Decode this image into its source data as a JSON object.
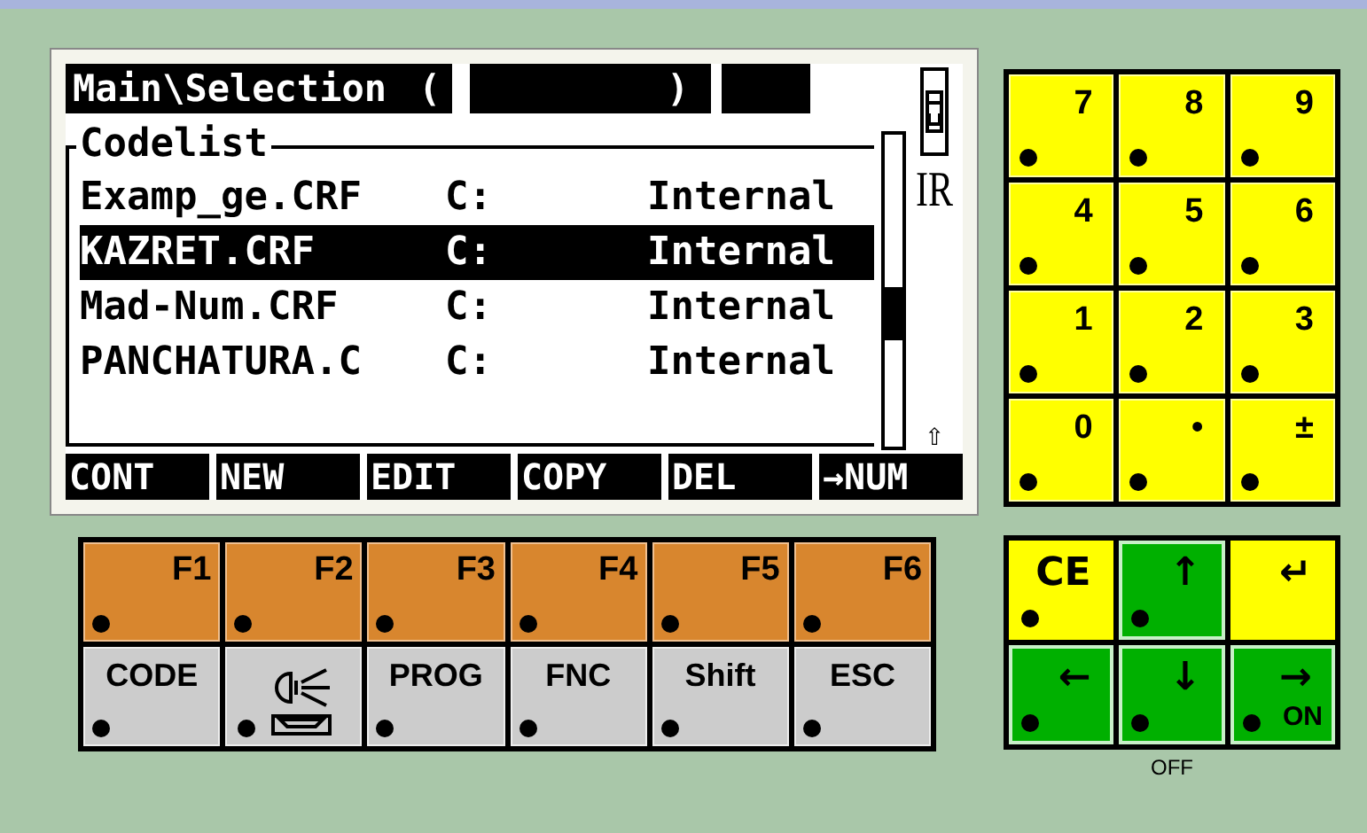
{
  "screen": {
    "title": "Main\\Selection",
    "paren_open": "(",
    "paren_close": ")",
    "ir_label": "IR",
    "scroll_arrow": "⇧",
    "list": {
      "title": "Codelist",
      "rows": [
        {
          "name": "Examp_ge.CRF",
          "drive": "C:",
          "location": "Internal",
          "selected": false
        },
        {
          "name": "KAZRET.CRF",
          "drive": "C:",
          "location": "Internal",
          "selected": true
        },
        {
          "name": "Mad-Num.CRF",
          "drive": "C:",
          "location": "Internal",
          "selected": false
        },
        {
          "name": "PANCHATURA.C",
          "drive": "C:",
          "location": "Internal",
          "selected": false
        }
      ]
    },
    "softkeys": [
      "CONT",
      "NEW",
      "EDIT",
      "COPY",
      "DEL",
      "→NUM"
    ]
  },
  "function_keys": [
    "F1",
    "F2",
    "F3",
    "F4",
    "F5",
    "F6"
  ],
  "command_keys": [
    {
      "kind": "text",
      "label": "CODE"
    },
    {
      "kind": "illumination"
    },
    {
      "kind": "text",
      "label": "PROG"
    },
    {
      "kind": "text",
      "label": "FNC"
    },
    {
      "kind": "text",
      "label": "Shift"
    },
    {
      "kind": "text",
      "label": "ESC"
    }
  ],
  "numpad": [
    "7",
    "8",
    "9",
    "4",
    "5",
    "6",
    "1",
    "2",
    "3",
    "0",
    "•",
    "±"
  ],
  "nav_keys": [
    {
      "label": "CE",
      "color": "#ffff00"
    },
    {
      "label": "↑",
      "color": "#00b000"
    },
    {
      "label": "↵",
      "color": "#ffff00"
    },
    {
      "label": "←",
      "color": "#00b000"
    },
    {
      "label": "↓",
      "color": "#00b000"
    },
    {
      "label": "→",
      "sub": "ON",
      "color": "#00b000"
    }
  ],
  "off_label": "OFF"
}
